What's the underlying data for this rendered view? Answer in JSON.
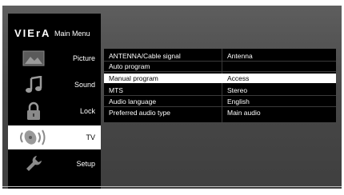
{
  "logo": "VIErA",
  "main_menu_title": "Main Menu",
  "sidebar": {
    "items": [
      {
        "label": "Picture",
        "icon": "picture-icon",
        "selected": false
      },
      {
        "label": "Sound",
        "icon": "music-note-icon",
        "selected": false
      },
      {
        "label": "Lock",
        "icon": "lock-icon",
        "selected": false
      },
      {
        "label": "TV",
        "icon": "satellite-dish-icon",
        "selected": true
      },
      {
        "label": "Setup",
        "icon": "wrench-icon",
        "selected": false
      }
    ]
  },
  "settings": {
    "rows": [
      {
        "label": "ANTENNA/Cable signal",
        "value": "Antenna",
        "selected": false
      },
      {
        "label": "Auto program",
        "value": "",
        "selected": false
      },
      {
        "label": "Manual program",
        "value": "Access",
        "selected": true
      },
      {
        "label": "MTS",
        "value": "Stereo",
        "selected": false
      },
      {
        "label": "Audio language",
        "value": "English",
        "selected": false
      },
      {
        "label": "Preferred audio type",
        "value": "Main audio",
        "selected": false
      }
    ]
  },
  "colors": {
    "screen_bg": "#4a4a4a",
    "panel_bg": "#000000",
    "highlight": "#ffffff"
  }
}
